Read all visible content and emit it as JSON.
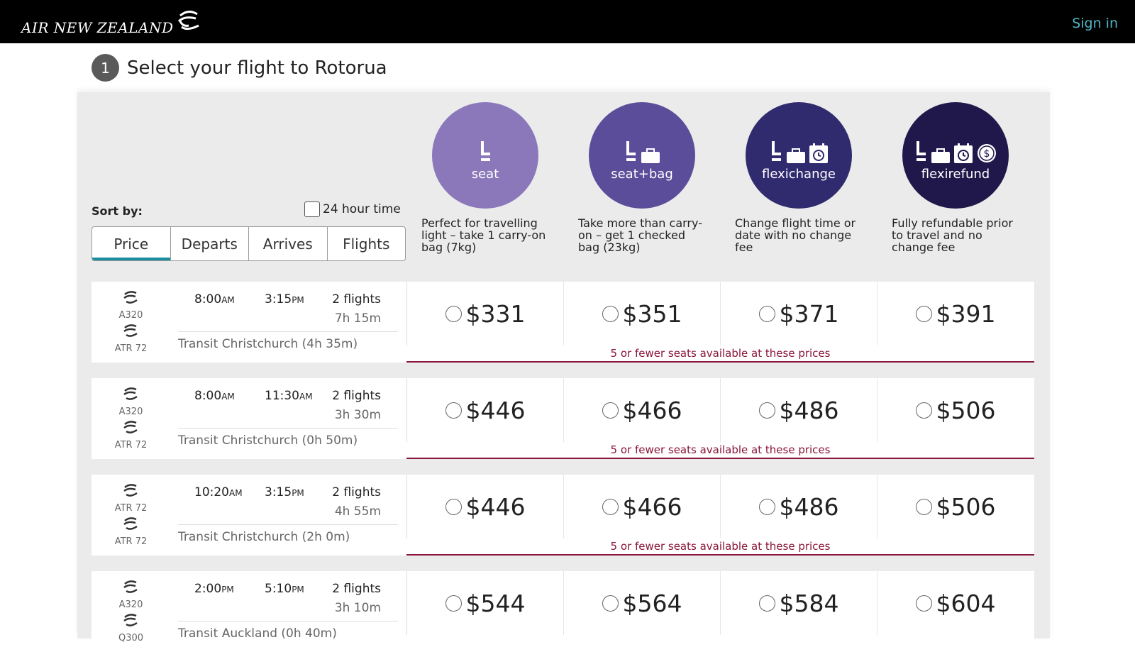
{
  "header": {
    "brand": "AIR NEW ZEALAND",
    "signin": "Sign in",
    "logo_icon": "koru-icon"
  },
  "step": {
    "number": "1",
    "title": "Select your flight to Rotorua"
  },
  "sort": {
    "label": "Sort by:",
    "hour24_label": "24 hour time",
    "tabs": [
      "Price",
      "Departs",
      "Arrives",
      "Flights"
    ],
    "active": "Price"
  },
  "fares": [
    {
      "name": "seat",
      "color": "#8a78bb",
      "icons": [
        "seat-icon"
      ],
      "description": "Perfect for travelling light – take 1 carry-on bag (7kg)"
    },
    {
      "name": "seat+bag",
      "color": "#5c4d9a",
      "icons": [
        "seat-icon",
        "bag-icon"
      ],
      "description": "Take more than carry-on – get 1 checked bag (23kg)"
    },
    {
      "name": "flexichange",
      "color": "#302a6e",
      "icons": [
        "seat-icon",
        "bag-icon",
        "calendar-clock-icon"
      ],
      "description": "Change flight time or date with no change fee"
    },
    {
      "name": "flexirefund",
      "color": "#20184a",
      "icons": [
        "seat-icon",
        "bag-icon",
        "calendar-clock-icon",
        "dollar-icon"
      ],
      "description": "Fully refundable prior to travel and no change fee"
    }
  ],
  "availability_note": "5 or fewer seats available at these prices",
  "flights": [
    {
      "aircraft": [
        "A320",
        "ATR 72"
      ],
      "depart": "8:00",
      "depart_ampm": "AM",
      "arrive": "3:15",
      "arrive_ampm": "PM",
      "count": "2 flights",
      "duration": "7h 15m",
      "transit": "Transit Christchurch (4h 35m)",
      "prices": [
        "$331",
        "$351",
        "$371",
        "$391"
      ],
      "limited": true
    },
    {
      "aircraft": [
        "A320",
        "ATR 72"
      ],
      "depart": "8:00",
      "depart_ampm": "AM",
      "arrive": "11:30",
      "arrive_ampm": "AM",
      "count": "2 flights",
      "duration": "3h 30m",
      "transit": "Transit Christchurch (0h 50m)",
      "prices": [
        "$446",
        "$466",
        "$486",
        "$506"
      ],
      "limited": true
    },
    {
      "aircraft": [
        "ATR 72",
        "ATR 72"
      ],
      "depart": "10:20",
      "depart_ampm": "AM",
      "arrive": "3:15",
      "arrive_ampm": "PM",
      "count": "2 flights",
      "duration": "4h 55m",
      "transit": "Transit Christchurch (2h 0m)",
      "prices": [
        "$446",
        "$466",
        "$486",
        "$506"
      ],
      "limited": true
    },
    {
      "aircraft": [
        "A320",
        "Q300"
      ],
      "depart": "2:00",
      "depart_ampm": "PM",
      "arrive": "5:10",
      "arrive_ampm": "PM",
      "count": "2 flights",
      "duration": "3h 10m",
      "transit": "Transit Auckland (0h 40m)",
      "prices": [
        "$544",
        "$564",
        "$584",
        "$604"
      ],
      "limited": false
    }
  ]
}
